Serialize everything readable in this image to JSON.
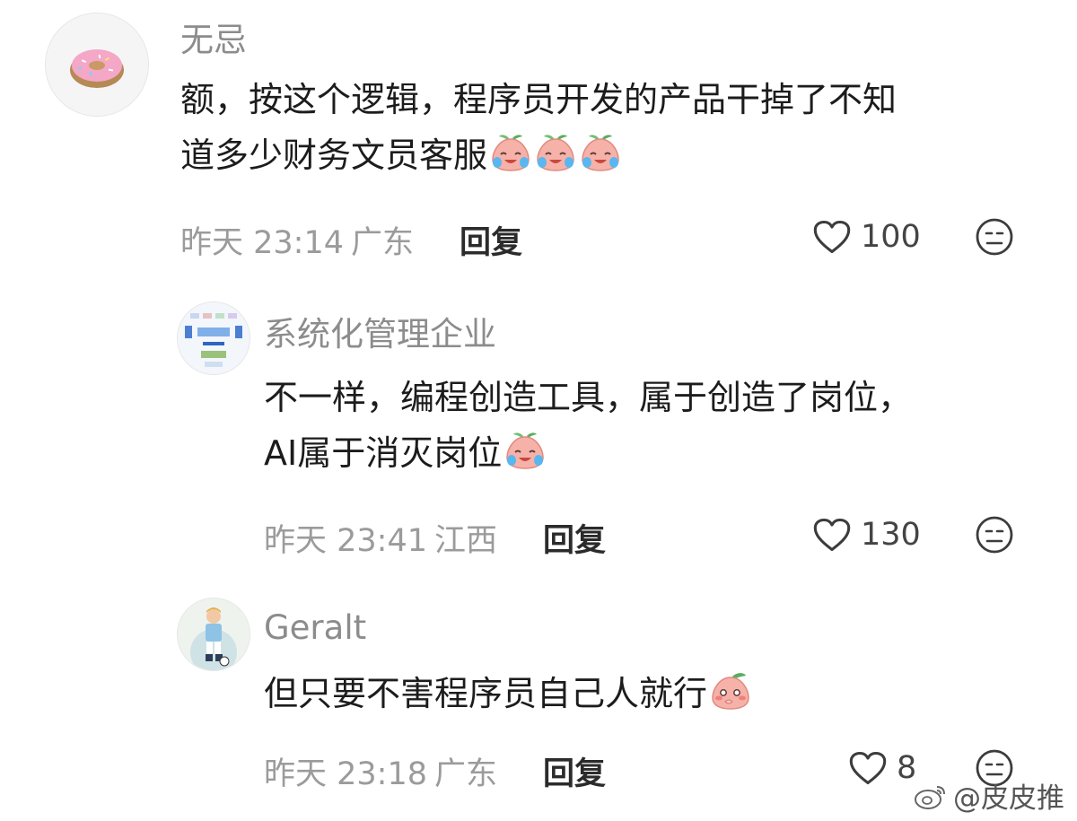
{
  "comments": [
    {
      "username": "无忌",
      "lines": [
        "额，按这个逻辑，程序员开发的产品干掉了不知",
        "道多少财务文员客服"
      ],
      "time": "昨天 23:14",
      "location": "广东",
      "reply_label": "回复",
      "likes": "100",
      "avatar_icon": "donut-avatar",
      "emoji": "crying-peach-emoji"
    },
    {
      "username": "系统化管理企业",
      "lines": [
        "不一样，编程创造工具，属于创造了岗位，",
        "AI属于消灭岗位"
      ],
      "time": "昨天 23:41",
      "location": "江西",
      "reply_label": "回复",
      "likes": "130",
      "avatar_icon": "diagram-avatar",
      "emoji": "crying-peach-emoji"
    },
    {
      "username": "Geralt",
      "lines": [
        "但只要不害程序员自己人就行"
      ],
      "time": "昨天 23:18",
      "location": "广东",
      "reply_label": "回复",
      "likes": "8",
      "avatar_icon": "soccer-player-avatar",
      "emoji": "blushing-peach-emoji"
    }
  ],
  "watermark": {
    "text": "@皮皮推",
    "icon": "weibo-logo-icon"
  },
  "colors": {
    "username": "#8c8c8c",
    "meta": "#9b9b9b",
    "text": "#1c1c1c",
    "emoji_peach": "#f4a39a"
  }
}
